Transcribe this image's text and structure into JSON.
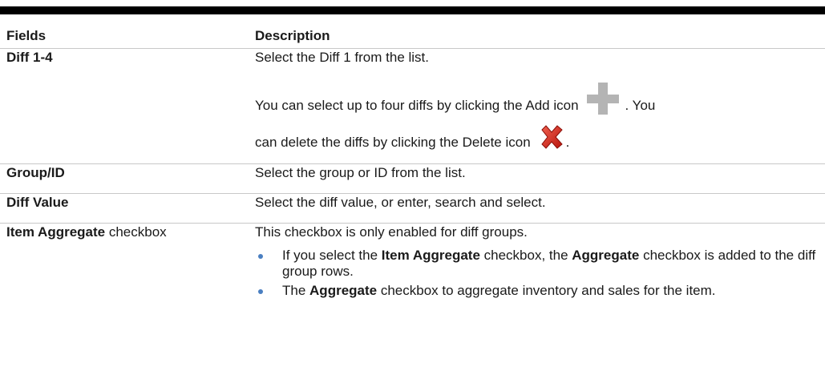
{
  "table": {
    "headers": {
      "fields": "Fields",
      "description": "Description"
    },
    "rows": {
      "diff": {
        "field": "Diff 1-4",
        "line1": "Select the Diff 1 from the list.",
        "line2": "You can select up to four diffs by clicking the Add icon",
        "line2_tail": ". You",
        "line3": "can delete the diffs by clicking the Delete icon",
        "line3_tail": "."
      },
      "group": {
        "field": "Group/ID",
        "description": "Select the group or ID from the list."
      },
      "value": {
        "field": "Diff Value",
        "description": "Select the diff value, or enter, search and select."
      },
      "aggregate": {
        "field_bold": "Item Aggregate",
        "field_plain": " checkbox",
        "description": "This checkbox is only enabled for diff groups.",
        "bullet1": {
          "pre": "If you select the ",
          "bold1": "Item Aggregate",
          "mid": " checkbox, the ",
          "bold2": "Aggregate",
          "post": " checkbox is added to the diff group rows."
        },
        "bullet2": {
          "pre": "The ",
          "bold": "Aggregate",
          "post": " checkbox to aggregate inventory and sales for the item."
        }
      }
    }
  },
  "icons": {
    "add": "plus-icon",
    "delete": "red-x-icon"
  },
  "colors": {
    "bullet": "#4a7fc1",
    "add_icon": "#b4b4b4",
    "delete_icon": "#d9261c"
  }
}
